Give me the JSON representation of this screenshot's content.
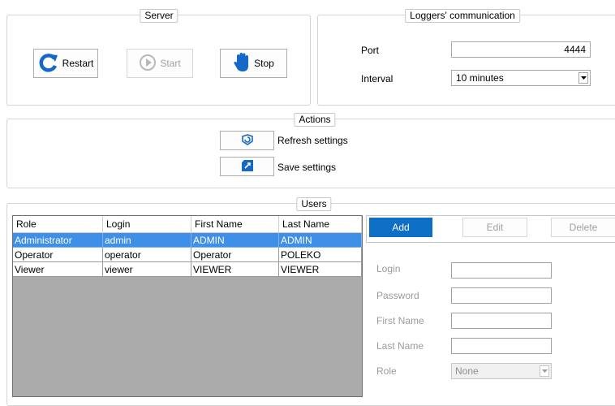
{
  "server": {
    "title": "Server",
    "restart_label": "Restart",
    "start_label": "Start",
    "stop_label": "Stop"
  },
  "comm": {
    "title": "Loggers' communication",
    "port_label": "Port",
    "port_value": "4444",
    "interval_label": "Interval",
    "interval_value": "10 minutes"
  },
  "actions": {
    "title": "Actions",
    "refresh_label": "Refresh settings",
    "save_label": "Save settings"
  },
  "users": {
    "title": "Users",
    "columns": [
      "Role",
      "Login",
      "First Name",
      "Last Name"
    ],
    "rows": [
      [
        "Administrator",
        "admin",
        "ADMIN",
        "ADMIN"
      ],
      [
        "Operator",
        "operator",
        "Operator",
        "POLEKO"
      ],
      [
        "Viewer",
        "viewer",
        "VIEWER",
        "VIEWER"
      ]
    ],
    "add_label": "Add",
    "edit_label": "Edit",
    "delete_label": "Delete",
    "form": {
      "login_label": "Login",
      "password_label": "Password",
      "first_name_label": "First Name",
      "last_name_label": "Last Name",
      "role_label": "Role",
      "role_value": "None"
    }
  },
  "colors": {
    "accent": "#0e6fc7",
    "selection": "#3d8fe8",
    "grid_empty": "#ababab"
  }
}
